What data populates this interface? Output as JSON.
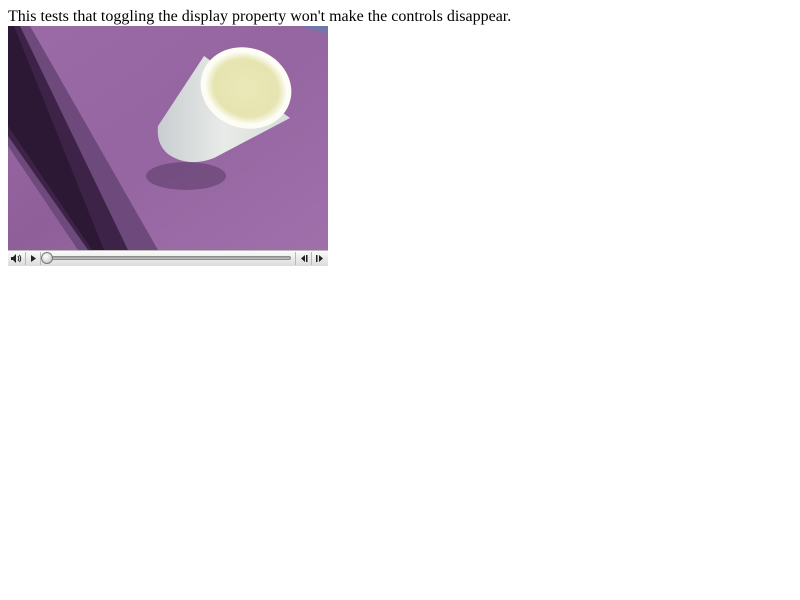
{
  "description": "This tests that toggling the display property won't make the controls disappear.",
  "video": {
    "frame_subject": "white paper cup on purple surface",
    "controls": {
      "mute_icon": "speaker-icon",
      "play_icon": "play-icon",
      "seek_back_icon": "rewind-icon",
      "seek_forward_icon": "fast-forward-icon",
      "progress": 0
    }
  },
  "colors": {
    "frame_purple": "#8a5a95",
    "frame_dark": "#3c2046",
    "cup": "#e4e8e4",
    "cup_rim": "#f6f2c8"
  }
}
